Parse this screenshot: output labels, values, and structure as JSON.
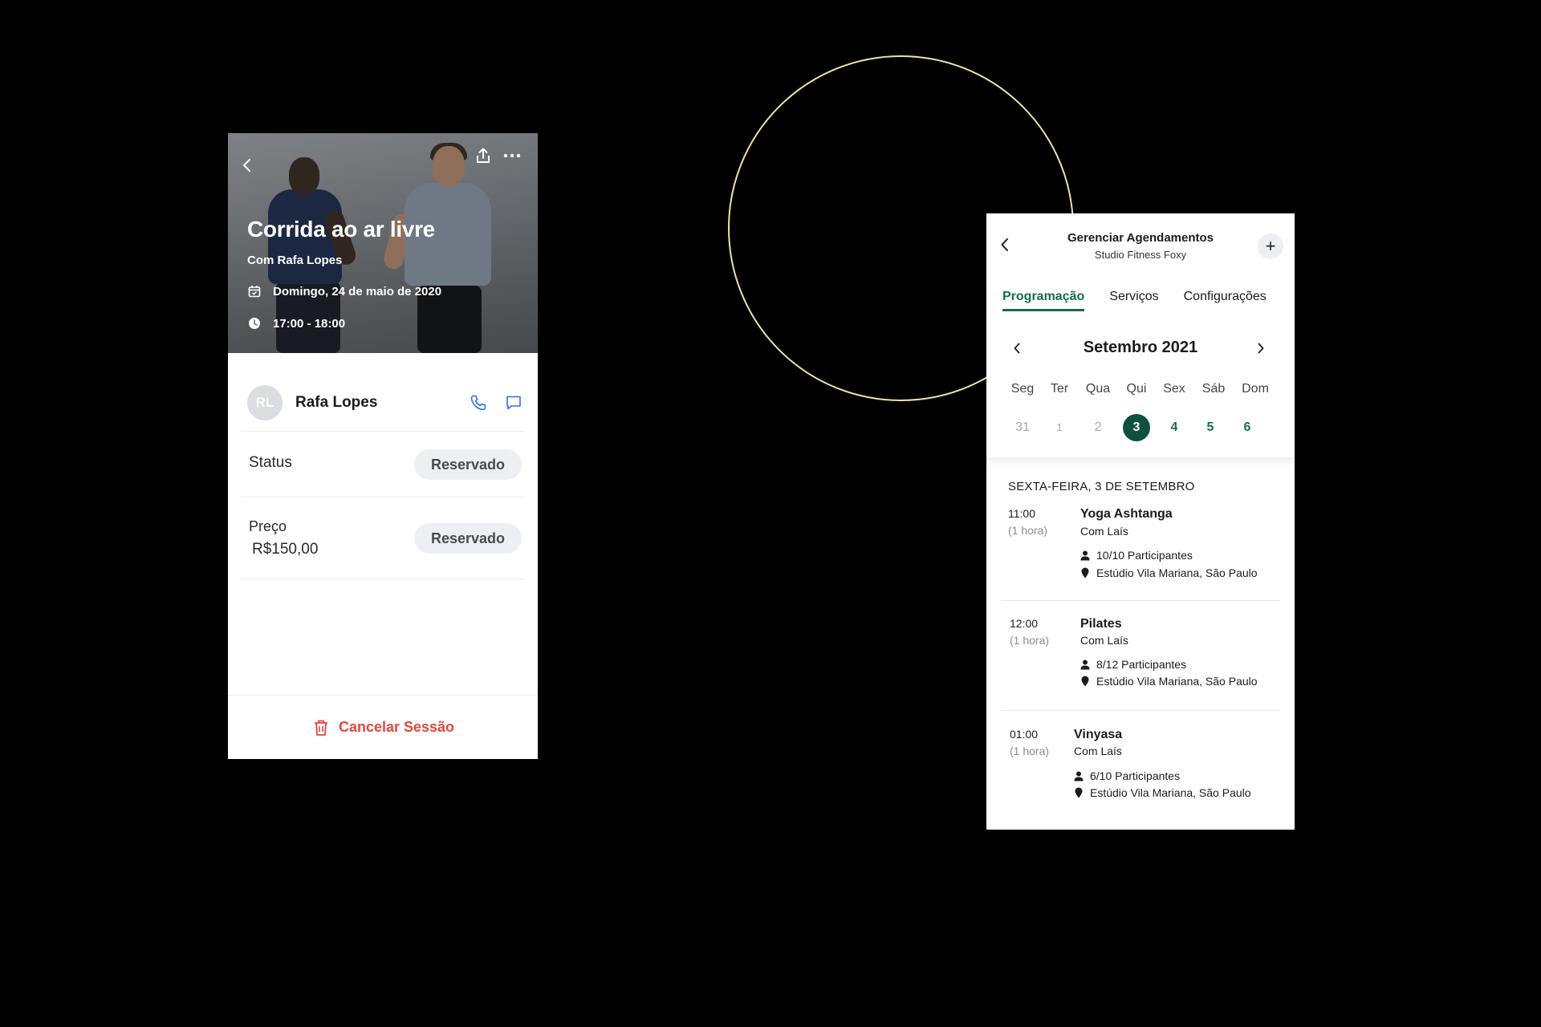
{
  "session_card": {
    "title": "Corrida ao ar livre",
    "instructor_line": "Com Rafa Lopes",
    "date": "Domingo, 24 de maio de 2020",
    "time": "17:00 - 18:00",
    "icons": [
      "back-icon",
      "share-icon",
      "more-icon",
      "calendar-icon",
      "clock-icon",
      "phone-icon",
      "chat-icon",
      "trash-icon"
    ],
    "contact": {
      "initials": "RL",
      "name": "Rafa Lopes"
    },
    "status": {
      "label": "Status",
      "value": "Reservado"
    },
    "price": {
      "label": "Preço",
      "amount": "R$150,00",
      "value": "Reservado"
    },
    "cancel_label": "Cancelar Sessão",
    "colors": {
      "danger": "#e8453c",
      "link_blue": "#2f6fe0"
    }
  },
  "schedule_card": {
    "title": "Gerenciar Agendamentos",
    "subtitle": "Studio Fitness Foxy",
    "plus_label": "+",
    "tabs": [
      "Programação",
      "Serviços",
      "Configurações"
    ],
    "active_tab": "Programação",
    "calendar": {
      "month": "Setembro 2021",
      "weekdays": [
        "Seg",
        "Ter",
        "Qua",
        "Qui",
        "Sex",
        "Sáb",
        "Dom"
      ],
      "days": [
        "31",
        "1",
        "2",
        "3",
        "4",
        "5",
        "6"
      ],
      "selected_day": "3"
    },
    "day_heading": "SEXTA-FEIRA, 3 DE SETEMBRO",
    "sessions": [
      {
        "time": "11:00",
        "duration": "(1 hora)",
        "name": "Yoga Ashtanga",
        "with": "Com Laís",
        "participants": "10/10 Participantes",
        "location": "Estúdio Vila Mariana, São Paulo"
      },
      {
        "time": "12:00",
        "duration": "(1 hora)",
        "name": "Pilates",
        "with": "Com Laís",
        "participants": "8/12 Participantes",
        "location": "Estúdio Vila Mariana, São Paulo"
      },
      {
        "time": "01:00",
        "duration": "(1 hora)",
        "name": "Vinyasa",
        "with": "Com Laís",
        "participants": "6/10 Participantes",
        "location": "Estúdio Vila Mariana, São Paulo"
      }
    ],
    "colors": {
      "accent": "#156d52",
      "selected_day_bg": "#0f5040"
    }
  }
}
